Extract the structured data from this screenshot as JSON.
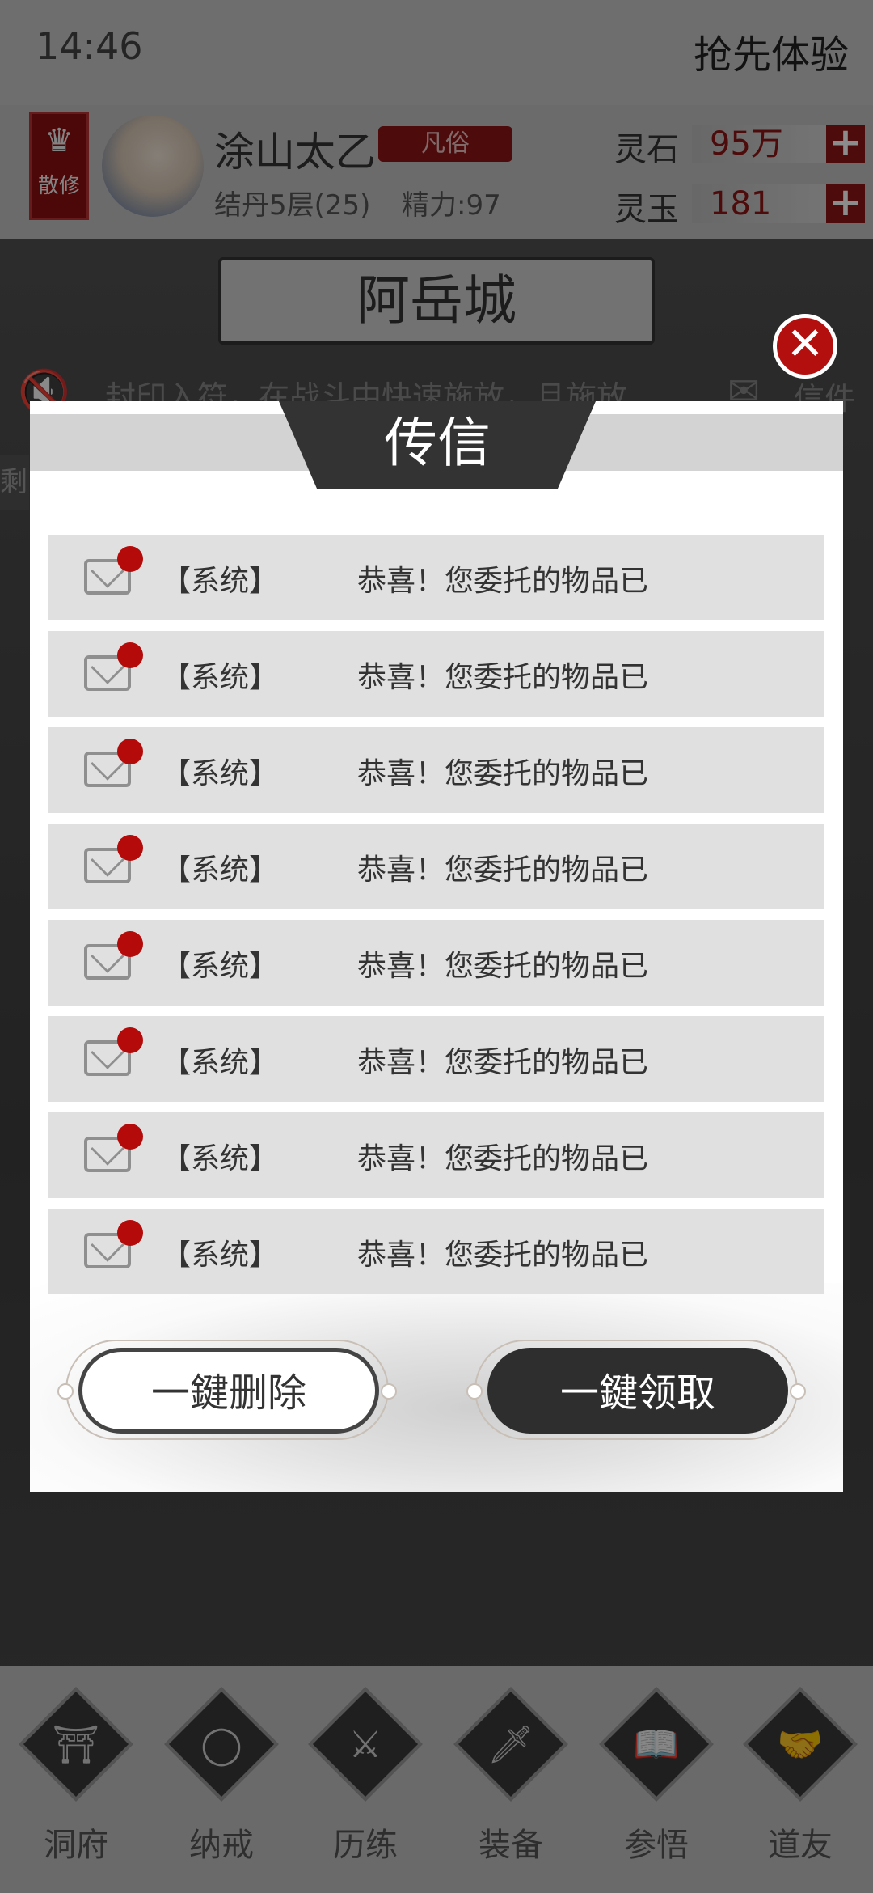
{
  "status": {
    "time": "14:46",
    "promo": "抢先体验"
  },
  "player": {
    "sect_glyph": "♛",
    "sect": "散修",
    "name": "涂山太乙",
    "rank": "凡俗",
    "realm": "结丹5层(25)",
    "energy": "精力:97",
    "resources": [
      {
        "name": "灵石",
        "value": "95万"
      },
      {
        "name": "灵玉",
        "value": "181"
      }
    ],
    "plus": "+"
  },
  "city": "阿岳城",
  "notice": {
    "icon": "mute-icon",
    "text": "封印入符，在战斗中快速施放，且施放",
    "mail_label": "信件",
    "left_edge": "剩"
  },
  "modal": {
    "title": "传信",
    "close": "✕",
    "messages": [
      {
        "sender": "【系统】",
        "subject": "恭喜！您委托的物品已"
      },
      {
        "sender": "【系统】",
        "subject": "恭喜！您委托的物品已"
      },
      {
        "sender": "【系统】",
        "subject": "恭喜！您委托的物品已"
      },
      {
        "sender": "【系统】",
        "subject": "恭喜！您委托的物品已"
      },
      {
        "sender": "【系统】",
        "subject": "恭喜！您委托的物品已"
      },
      {
        "sender": "【系统】",
        "subject": "恭喜！您委托的物品已"
      },
      {
        "sender": "【系统】",
        "subject": "恭喜！您委托的物品已"
      },
      {
        "sender": "【系统】",
        "subject": "恭喜！您委托的物品已"
      }
    ],
    "delete_all": "一鍵删除",
    "claim_all": "一鍵领取"
  },
  "nav": [
    {
      "label": "洞府",
      "icon": "gate-icon",
      "glyph": "⛩"
    },
    {
      "label": "纳戒",
      "icon": "ring-icon",
      "glyph": "◯"
    },
    {
      "label": "历练",
      "icon": "crossed-swords-icon",
      "glyph": "⚔"
    },
    {
      "label": "装备",
      "icon": "dagger-icon",
      "glyph": "🗡"
    },
    {
      "label": "参悟",
      "icon": "book-icon",
      "glyph": "📖"
    },
    {
      "label": "道友",
      "icon": "handshake-icon",
      "glyph": "🤝"
    }
  ],
  "colors": {
    "accent_red": "#b30f0f",
    "dark": "#2e2e2e"
  }
}
